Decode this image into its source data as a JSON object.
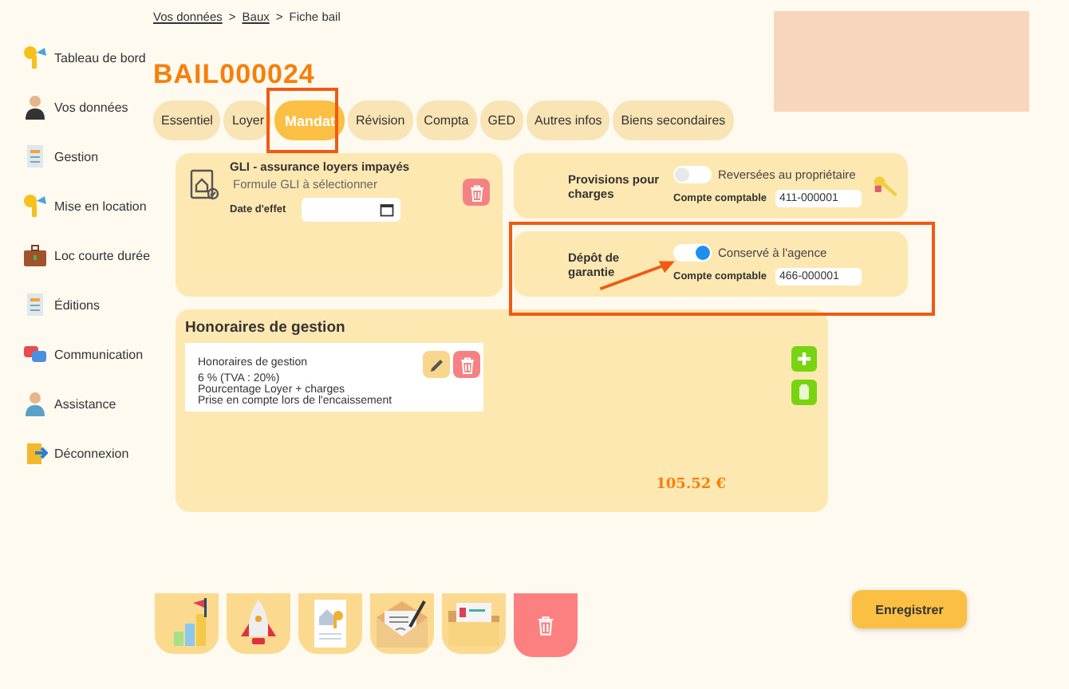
{
  "sidebar": {
    "items": [
      {
        "label": "Tableau de bord"
      },
      {
        "label": "Vos données"
      },
      {
        "label": "Gestion"
      },
      {
        "label": "Mise en location"
      },
      {
        "label": "Loc courte durée"
      },
      {
        "label": "Éditions"
      },
      {
        "label": "Communication"
      },
      {
        "label": "Assistance"
      },
      {
        "label": "Déconnexion"
      }
    ]
  },
  "breadcrumb": {
    "links": [
      "Vos données",
      "Baux"
    ],
    "separators": [
      ">",
      ">"
    ],
    "current": "Fiche bail"
  },
  "title": "BAIL000024",
  "tabs": [
    {
      "label": "Essentiel",
      "selected": false
    },
    {
      "label": "Loyer",
      "selected": false
    },
    {
      "label": "Mandat",
      "selected": true
    },
    {
      "label": "Révision",
      "selected": false
    },
    {
      "label": "Compta",
      "selected": false
    },
    {
      "label": "GED",
      "selected": false
    },
    {
      "label": "Autres infos",
      "selected": false
    },
    {
      "label": "Biens secondaires",
      "selected": false
    }
  ],
  "gli": {
    "title": "GLI - assurance loyers impayés",
    "formula": "Formule GLI à sélectionner",
    "date_label": "Date d'effet"
  },
  "accounts": [
    {
      "kind": "provisions",
      "label": "Provisions pour charges",
      "switch_label": "Reversées au propriétaire",
      "on": false,
      "account_label": "Compte comptable",
      "account": "411-000001"
    },
    {
      "kind": "deposit",
      "label": "Dépôt de garantie",
      "switch_label": "Conservé à l'agence",
      "on": true,
      "account_label": "Compte comptable",
      "account": "466-000001"
    }
  ],
  "fees": {
    "title": "Honoraires de gestion",
    "items": [
      {
        "name": "Honoraires de gestion",
        "rate": "6 % (TVA : 20%)",
        "basis": "Pourcentage Loyer + charges",
        "timing": "Prise en compte lors de l'encaissement"
      }
    ],
    "total": "105.52 €"
  },
  "save_button": "Enregistrer"
}
